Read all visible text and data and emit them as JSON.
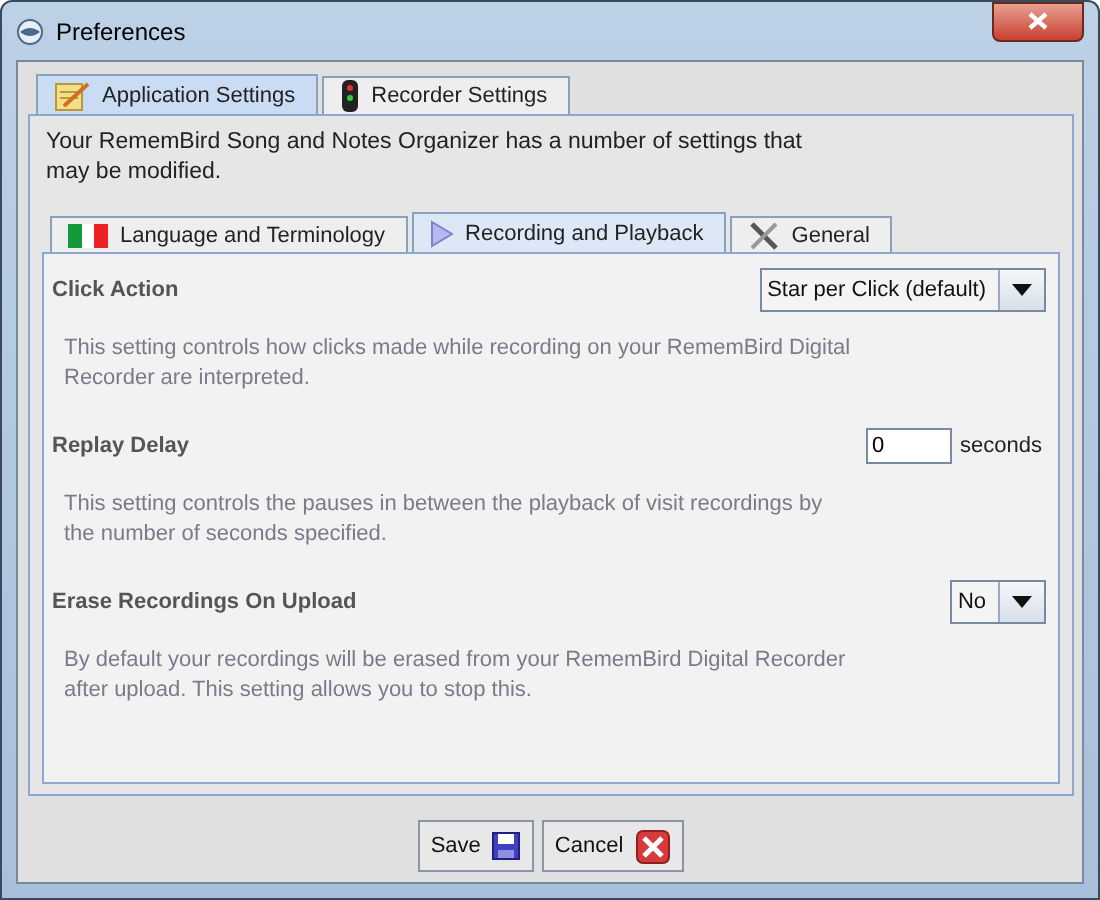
{
  "window": {
    "title": "Preferences"
  },
  "outer_tabs": [
    {
      "label": "Application Settings",
      "selected": true
    },
    {
      "label": "Recorder Settings",
      "selected": false
    }
  ],
  "intro": "Your RememBird Song and Notes Organizer has a number of settings that may be modified.",
  "inner_tabs": [
    {
      "label": "Language and Terminology",
      "selected": false
    },
    {
      "label": "Recording and Playback",
      "selected": true
    },
    {
      "label": "General",
      "selected": false
    }
  ],
  "settings": [
    {
      "kind": "dropdown",
      "label": "Click Action",
      "value": "Star per Click (default)",
      "description": "This setting controls how clicks made while recording on your RememBird Digital Recorder are interpreted."
    },
    {
      "kind": "number",
      "label": "Replay Delay",
      "value": "0",
      "unit": "seconds",
      "description": "This setting controls the pauses in between the playback of visit recordings by the number of seconds specified."
    },
    {
      "kind": "dropdown",
      "label": "Erase Recordings On Upload",
      "value": "No",
      "description": "By default your recordings will be erased from your RememBird Digital Recorder after upload. This setting allows you to stop this."
    }
  ],
  "buttons": [
    "Save",
    "Cancel"
  ]
}
